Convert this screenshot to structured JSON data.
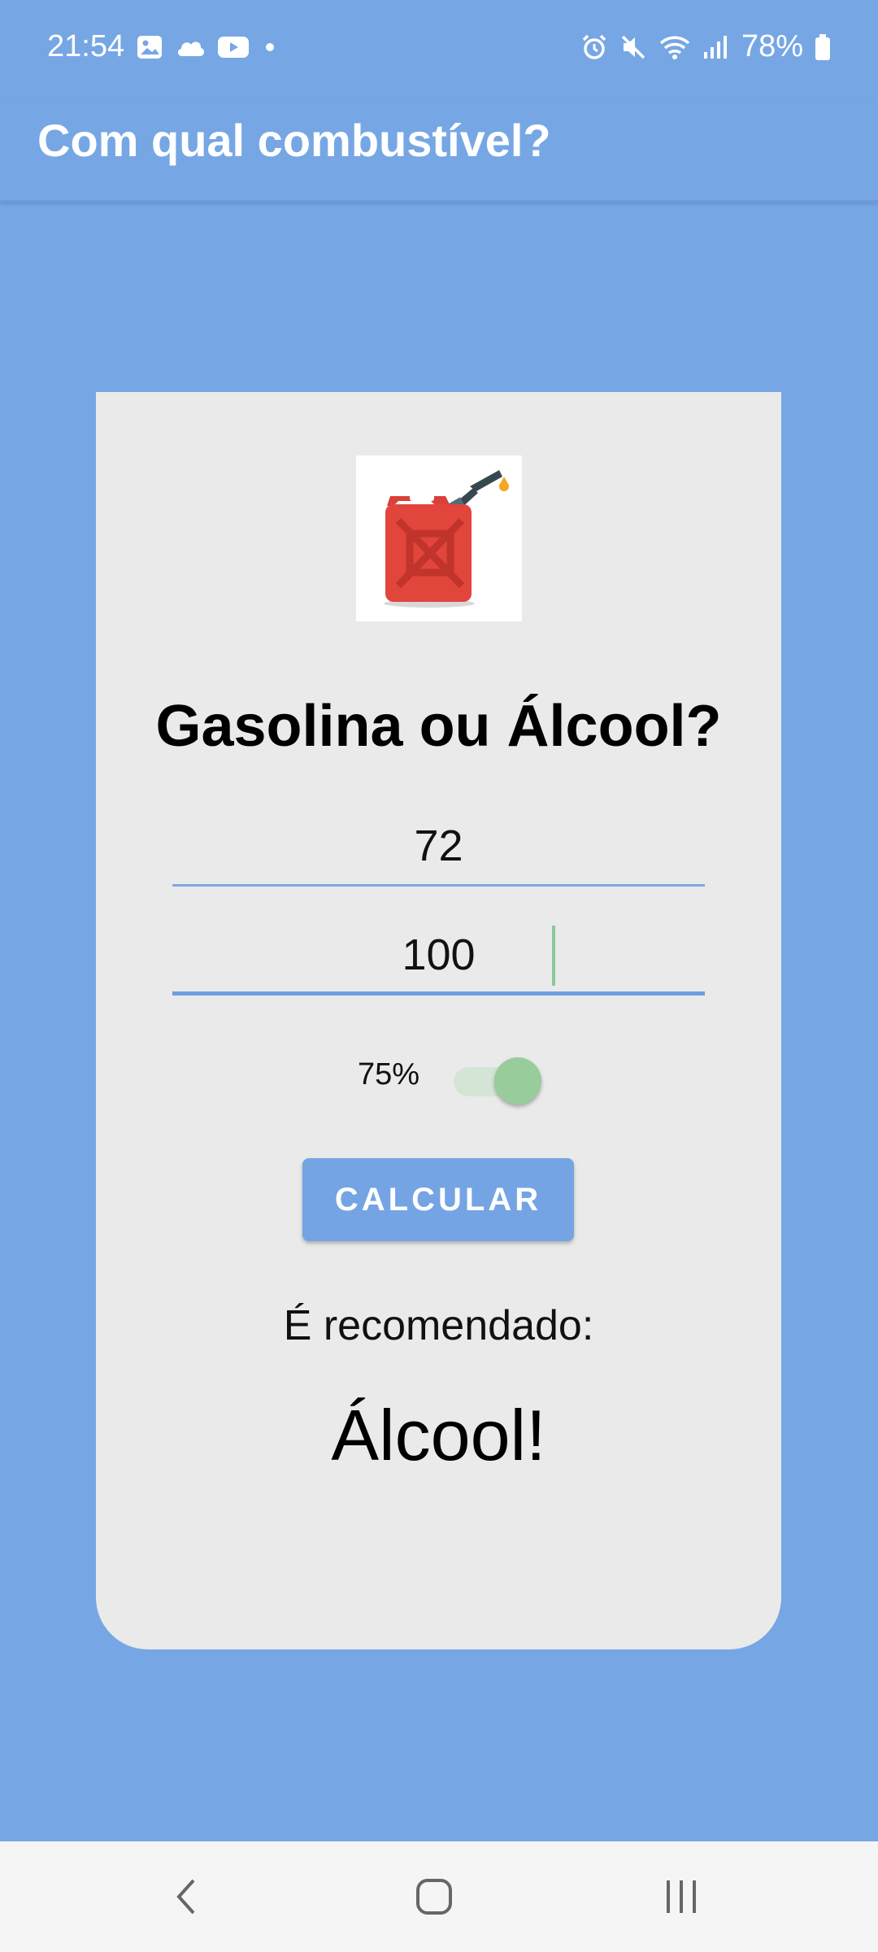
{
  "status_bar": {
    "time": "21:54",
    "left_icons": [
      "gallery-icon",
      "cloud-icon",
      "youtube-icon",
      "dot-icon"
    ],
    "right_icons": [
      "alarm-icon",
      "mute-icon",
      "wifi-icon",
      "signal-icon",
      "battery-icon"
    ],
    "battery": "78%"
  },
  "app_bar": {
    "title": "Com qual combustível?"
  },
  "card": {
    "illustration": "fuel-can-icon",
    "headline": "Gasolina ou Álcool?",
    "input_alcool": "72",
    "input_gasolina": "100",
    "ratio_label": "75%",
    "ratio_toggle_on": true,
    "button_label": "CALCULAR",
    "result_label": "É recomendado:",
    "result_value": "Álcool!"
  },
  "nav_bar": {
    "buttons": [
      "back-icon",
      "home-icon",
      "recents-icon"
    ]
  },
  "colors": {
    "background": "#76a7e4",
    "card": "#eaeaea",
    "accent": "#74a4e4",
    "toggle": "#99cc9b"
  }
}
